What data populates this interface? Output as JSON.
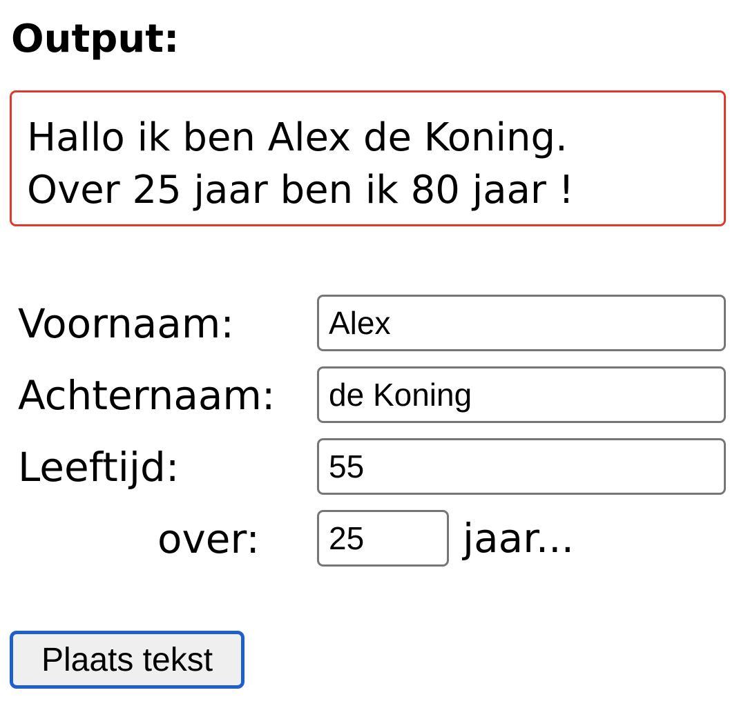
{
  "heading": "Output:",
  "output": {
    "line1": "Hallo ik ben Alex de Koning.",
    "line2": "Over 25 jaar ben ik 80 jaar !"
  },
  "form": {
    "firstname_label": "Voornaam:",
    "firstname_value": "Alex",
    "lastname_label": "Achternaam:",
    "lastname_value": "de Koning",
    "age_label": "Leeftijd:",
    "age_value": "55",
    "years_label": "over:",
    "years_value": "25",
    "years_suffix": "jaar..."
  },
  "button": {
    "label": "Plaats tekst"
  },
  "colors": {
    "output_border": "#e0392b",
    "button_focus_border": "#1f5fcc",
    "input_border": "#767676"
  }
}
